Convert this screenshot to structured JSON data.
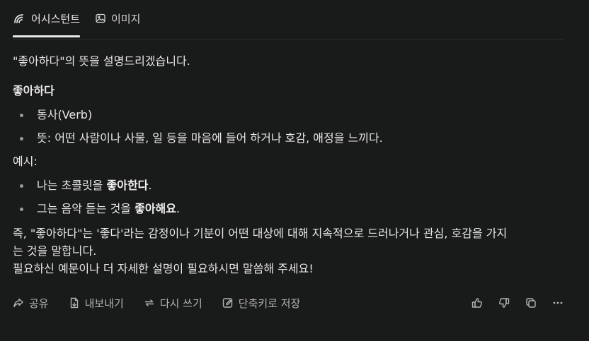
{
  "tabs": [
    {
      "label": "어시스턴트",
      "icon": "perplexity-assistant-icon",
      "active": true
    },
    {
      "label": "이미지",
      "icon": "image-icon",
      "active": false
    }
  ],
  "answer": {
    "intro": "\"좋아하다\"의 뜻을 설명드리겠습니다.",
    "heading": "좋아하다",
    "definitions": [
      "동사(Verb)",
      "뜻: 어떤 사람이나 사물, 일 등을 마음에 들어 하거나 호감, 애정을 느끼다."
    ],
    "example_label": "예시:",
    "examples": [
      {
        "prefix": "나는 초콜릿을 ",
        "bold": "좋아한다",
        "suffix": "."
      },
      {
        "prefix": "그는 음악 듣는 것을 ",
        "bold": "좋아해요",
        "suffix": "."
      }
    ],
    "summary_line1": "즉, \"좋아하다\"는 '좋다'라는 감정이나 기분이 어떤 대상에 대해 지속적으로 드러나거나 관심, 호감을 가지",
    "summary_line2": "는 것을 말합니다.",
    "summary_line3": "필요하신 예문이나 더 자세한 설명이 필요하시면 말씀해 주세요!"
  },
  "actions": {
    "share": "공유",
    "export": "내보내기",
    "rewrite": "다시 쓰기",
    "shortcut": "단축키로 저장"
  },
  "colors": {
    "background": "#191a1a",
    "text": "#e8e8e6",
    "muted": "#b4b4b2"
  }
}
